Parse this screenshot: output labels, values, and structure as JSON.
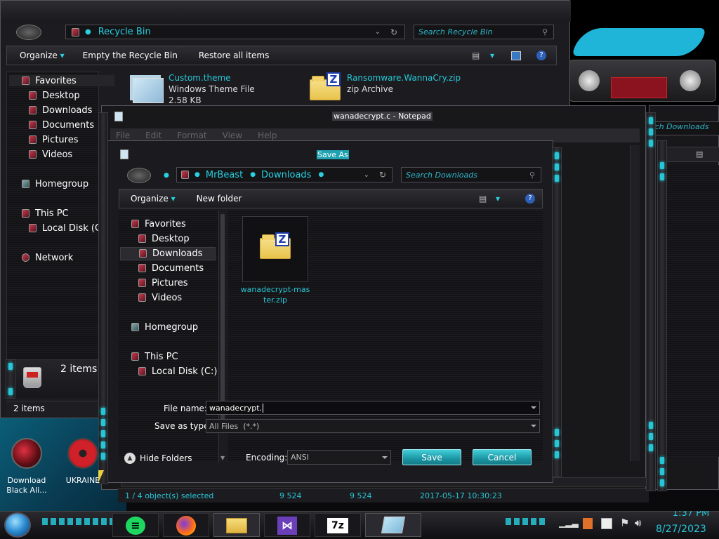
{
  "recycle": {
    "breadcrumb": "Recycle Bin",
    "search_placeholder": "Search Recycle Bin",
    "toolbar": {
      "organize": "Organize",
      "empty": "Empty the Recycle Bin",
      "restore": "Restore all items"
    },
    "sidebar": {
      "favorites": "Favorites",
      "items": [
        "Desktop",
        "Downloads",
        "Documents",
        "Pictures",
        "Videos"
      ],
      "homegroup": "Homegroup",
      "this_pc": "This PC",
      "local_disk": "Local Disk (C:",
      "network": "Network"
    },
    "files": [
      {
        "name": "Custom.theme",
        "type": "Windows Theme File",
        "size": "2.58 KB"
      },
      {
        "name": "Ransomware.WannaCry.zip",
        "type": "zip Archive"
      }
    ],
    "details_count": "2 items",
    "status": "2 items"
  },
  "notepad": {
    "title": "wanadecrypt.c - Notepad",
    "menu": [
      "File",
      "Edit",
      "Format",
      "View",
      "Help"
    ]
  },
  "behind_search": "rch Downloads",
  "saveas": {
    "title": "Save As",
    "breadcrumb": [
      "MrBeast",
      "Downloads"
    ],
    "search_placeholder": "Search Downloads",
    "toolbar": {
      "organize": "Organize",
      "new_folder": "New folder"
    },
    "sidebar": {
      "favorites": "Favorites",
      "items": [
        "Desktop",
        "Downloads",
        "Documents",
        "Pictures",
        "Videos"
      ],
      "selected": "Downloads",
      "homegroup": "Homegroup",
      "this_pc": "This PC",
      "local_disk": "Local Disk (C:)"
    },
    "file": {
      "name": "wanadecrypt-master.zip",
      "line1": "wanadecrypt-mas",
      "line2": "ter.zip"
    },
    "filename_label": "File name:",
    "filename_value": "wanadecrypt.",
    "savetype_label": "Save as type:",
    "savetype_value": "All Files  (*.*)",
    "hide_folders": "Hide Folders",
    "encoding_label": "Encoding:",
    "encoding_value": "ANSI",
    "save": "Save",
    "cancel": "Cancel"
  },
  "bottom_status": {
    "selected": "1 / 4 object(s) selected",
    "v1": "9 524",
    "v2": "9 524",
    "date": "2017-05-17 10:30:23"
  },
  "desktop": {
    "icons": [
      {
        "label1": "Download",
        "label2": "Black Ali..."
      },
      {
        "label1": "UKRAINE"
      }
    ]
  },
  "taskbar": {
    "apps": [
      "spotify",
      "firefox",
      "file-explorer",
      "visual-studio",
      "7-zip",
      "notepad"
    ],
    "time": "1:37 PM",
    "date": "8/27/2023"
  },
  "colors": {
    "accent": "#27c6d6",
    "button": "#1b95a3"
  }
}
